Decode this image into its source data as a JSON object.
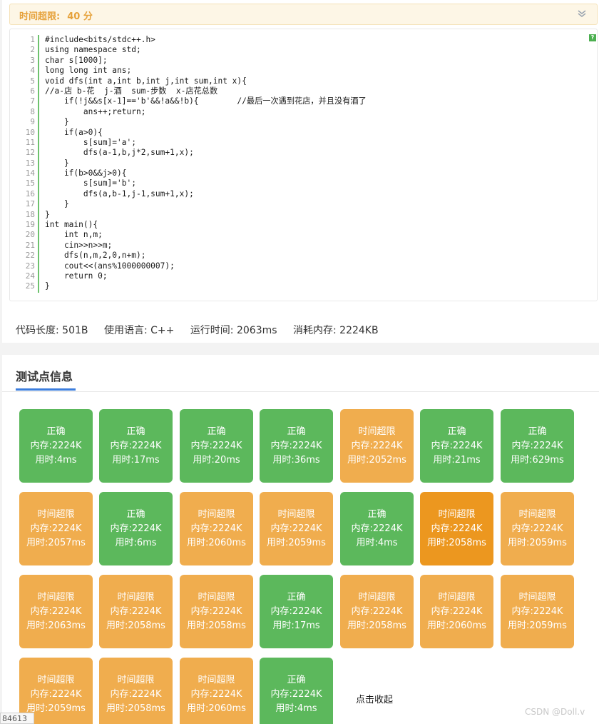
{
  "time_limit": {
    "label": "时间超限:",
    "value": "40 分"
  },
  "code_lines": [
    "#include<bits/stdc++.h>",
    "using namespace std;",
    "char s[1000];",
    "long long int ans;",
    "void dfs(int a,int b,int j,int sum,int x){",
    "//a-店 b-花  j-酒  sum-步数  x-店花总数",
    "    if(!j&&s[x-1]=='b'&&!a&&!b){        //最后一次遇到花店，并且没有酒了",
    "        ans++;return;",
    "    }",
    "    if(a>0){",
    "        s[sum]='a';",
    "        dfs(a-1,b,j*2,sum+1,x);",
    "    }",
    "    if(b>0&&j>0){",
    "        s[sum]='b';",
    "        dfs(a,b-1,j-1,sum+1,x);",
    "    }",
    "}",
    "int main(){",
    "    int n,m;",
    "    cin>>n>>m;",
    "    dfs(n,m,2,0,n+m);",
    "    cout<<(ans%1000000007);",
    "    return 0;",
    "}"
  ],
  "line_numbers": [
    "1",
    "2",
    "3",
    "4",
    "5",
    "6",
    "7",
    "8",
    "9",
    "10",
    "11",
    "12",
    "13",
    "14",
    "15",
    "16",
    "17",
    "18",
    "19",
    "20",
    "21",
    "22",
    "23",
    "24",
    "25"
  ],
  "help_badge": "?",
  "stats": {
    "code_length": "代码长度: 501B",
    "language": "使用语言: C++",
    "run_time": "运行时间: 2063ms",
    "memory": "消耗内存: 2224KB"
  },
  "section_title": "测试点信息",
  "colors": {
    "accepted": "#5cb85c",
    "time_limit_exceeded": "#f0ad4e",
    "tle_selected": "#ec971f",
    "tab_accent": "#3b7ddd"
  },
  "test_points": [
    {
      "status": "正确",
      "memory": "内存:2224K",
      "time": "用时:4ms",
      "kind": "ac"
    },
    {
      "status": "正确",
      "memory": "内存:2224K",
      "time": "用时:17ms",
      "kind": "ac"
    },
    {
      "status": "正确",
      "memory": "内存:2224K",
      "time": "用时:20ms",
      "kind": "ac"
    },
    {
      "status": "正确",
      "memory": "内存:2224K",
      "time": "用时:36ms",
      "kind": "ac"
    },
    {
      "status": "时间超限",
      "memory": "内存:2224K",
      "time": "用时:2052ms",
      "kind": "tle"
    },
    {
      "status": "正确",
      "memory": "内存:2224K",
      "time": "用时:21ms",
      "kind": "ac"
    },
    {
      "status": "正确",
      "memory": "内存:2224K",
      "time": "用时:629ms",
      "kind": "ac"
    },
    {
      "status": "时间超限",
      "memory": "内存:2224K",
      "time": "用时:2057ms",
      "kind": "tle"
    },
    {
      "status": "正确",
      "memory": "内存:2224K",
      "time": "用时:6ms",
      "kind": "ac"
    },
    {
      "status": "时间超限",
      "memory": "内存:2224K",
      "time": "用时:2060ms",
      "kind": "tle"
    },
    {
      "status": "时间超限",
      "memory": "内存:2224K",
      "time": "用时:2059ms",
      "kind": "tle"
    },
    {
      "status": "正确",
      "memory": "内存:2224K",
      "time": "用时:4ms",
      "kind": "ac"
    },
    {
      "status": "时间超限",
      "memory": "内存:2224K",
      "time": "用时:2058ms",
      "kind": "tle",
      "selected": true
    },
    {
      "status": "时间超限",
      "memory": "内存:2224K",
      "time": "用时:2059ms",
      "kind": "tle"
    },
    {
      "status": "时间超限",
      "memory": "内存:2224K",
      "time": "用时:2063ms",
      "kind": "tle"
    },
    {
      "status": "时间超限",
      "memory": "内存:2224K",
      "time": "用时:2058ms",
      "kind": "tle"
    },
    {
      "status": "时间超限",
      "memory": "内存:2224K",
      "time": "用时:2058ms",
      "kind": "tle"
    },
    {
      "status": "正确",
      "memory": "内存:2224K",
      "time": "用时:17ms",
      "kind": "ac"
    },
    {
      "status": "时间超限",
      "memory": "内存:2224K",
      "time": "用时:2058ms",
      "kind": "tle"
    },
    {
      "status": "时间超限",
      "memory": "内存:2224K",
      "time": "用时:2060ms",
      "kind": "tle"
    },
    {
      "status": "时间超限",
      "memory": "内存:2224K",
      "time": "用时:2059ms",
      "kind": "tle"
    },
    {
      "status": "时间超限",
      "memory": "内存:2224K",
      "time": "用时:2059ms",
      "kind": "tle"
    },
    {
      "status": "时间超限",
      "memory": "内存:2224K",
      "time": "用时:2058ms",
      "kind": "tle"
    },
    {
      "status": "时间超限",
      "memory": "内存:2224K",
      "time": "用时:2060ms",
      "kind": "tle"
    },
    {
      "status": "正确",
      "memory": "内存:2224K",
      "time": "用时:4ms",
      "kind": "ac"
    }
  ],
  "collapse_label": "点击收起",
  "watermark": "CSDN @Doll.v",
  "corner_tag": "84613"
}
